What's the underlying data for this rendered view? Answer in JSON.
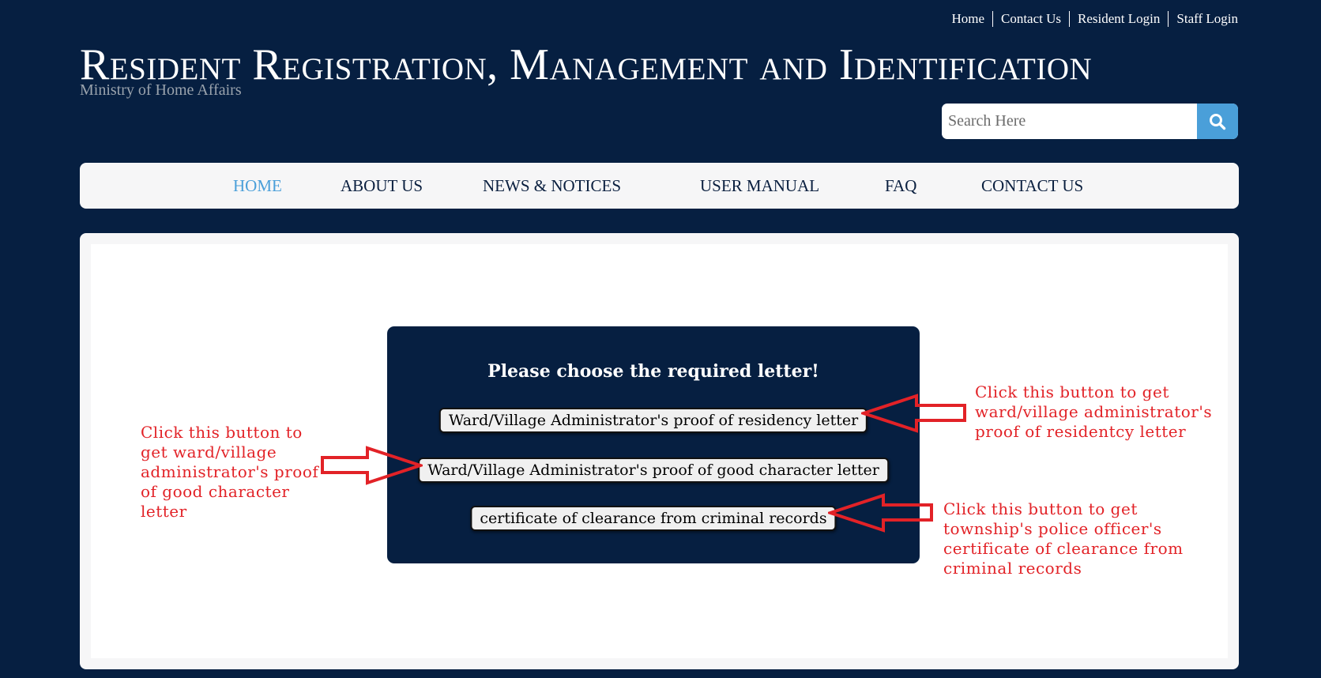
{
  "top_links": [
    "Home",
    "Contact Us",
    "Resident Login",
    "Staff Login"
  ],
  "site": {
    "title": "Resident Registration, Management and Identification",
    "subtitle": "Ministry of Home Affairs"
  },
  "search": {
    "placeholder": "Search Here",
    "icon": "search-icon"
  },
  "nav": {
    "items": [
      "HOME",
      "ABOUT US",
      "NEWS & NOTICES",
      "USER MANUAL",
      "FAQ",
      "CONTACT US"
    ],
    "active": "HOME"
  },
  "dialog": {
    "title": "Please choose the required letter!",
    "buttons": [
      "Ward/Village Administrator's proof of residency letter",
      "Ward/Village Administrator's proof of good character letter",
      "certificate of clearance from criminal records"
    ]
  },
  "annotations": [
    "Click this button to get ward/village administrator's proof of residentcy letter",
    "Click this button to get ward/village administrator's proof of good character letter",
    "Click this button to get township's police officer's certificate of clearance from criminal records"
  ],
  "colors": {
    "background": "#061f41",
    "accent": "#4a9fd9",
    "annotation": "#e22227",
    "panel": "#f6f6f7"
  }
}
